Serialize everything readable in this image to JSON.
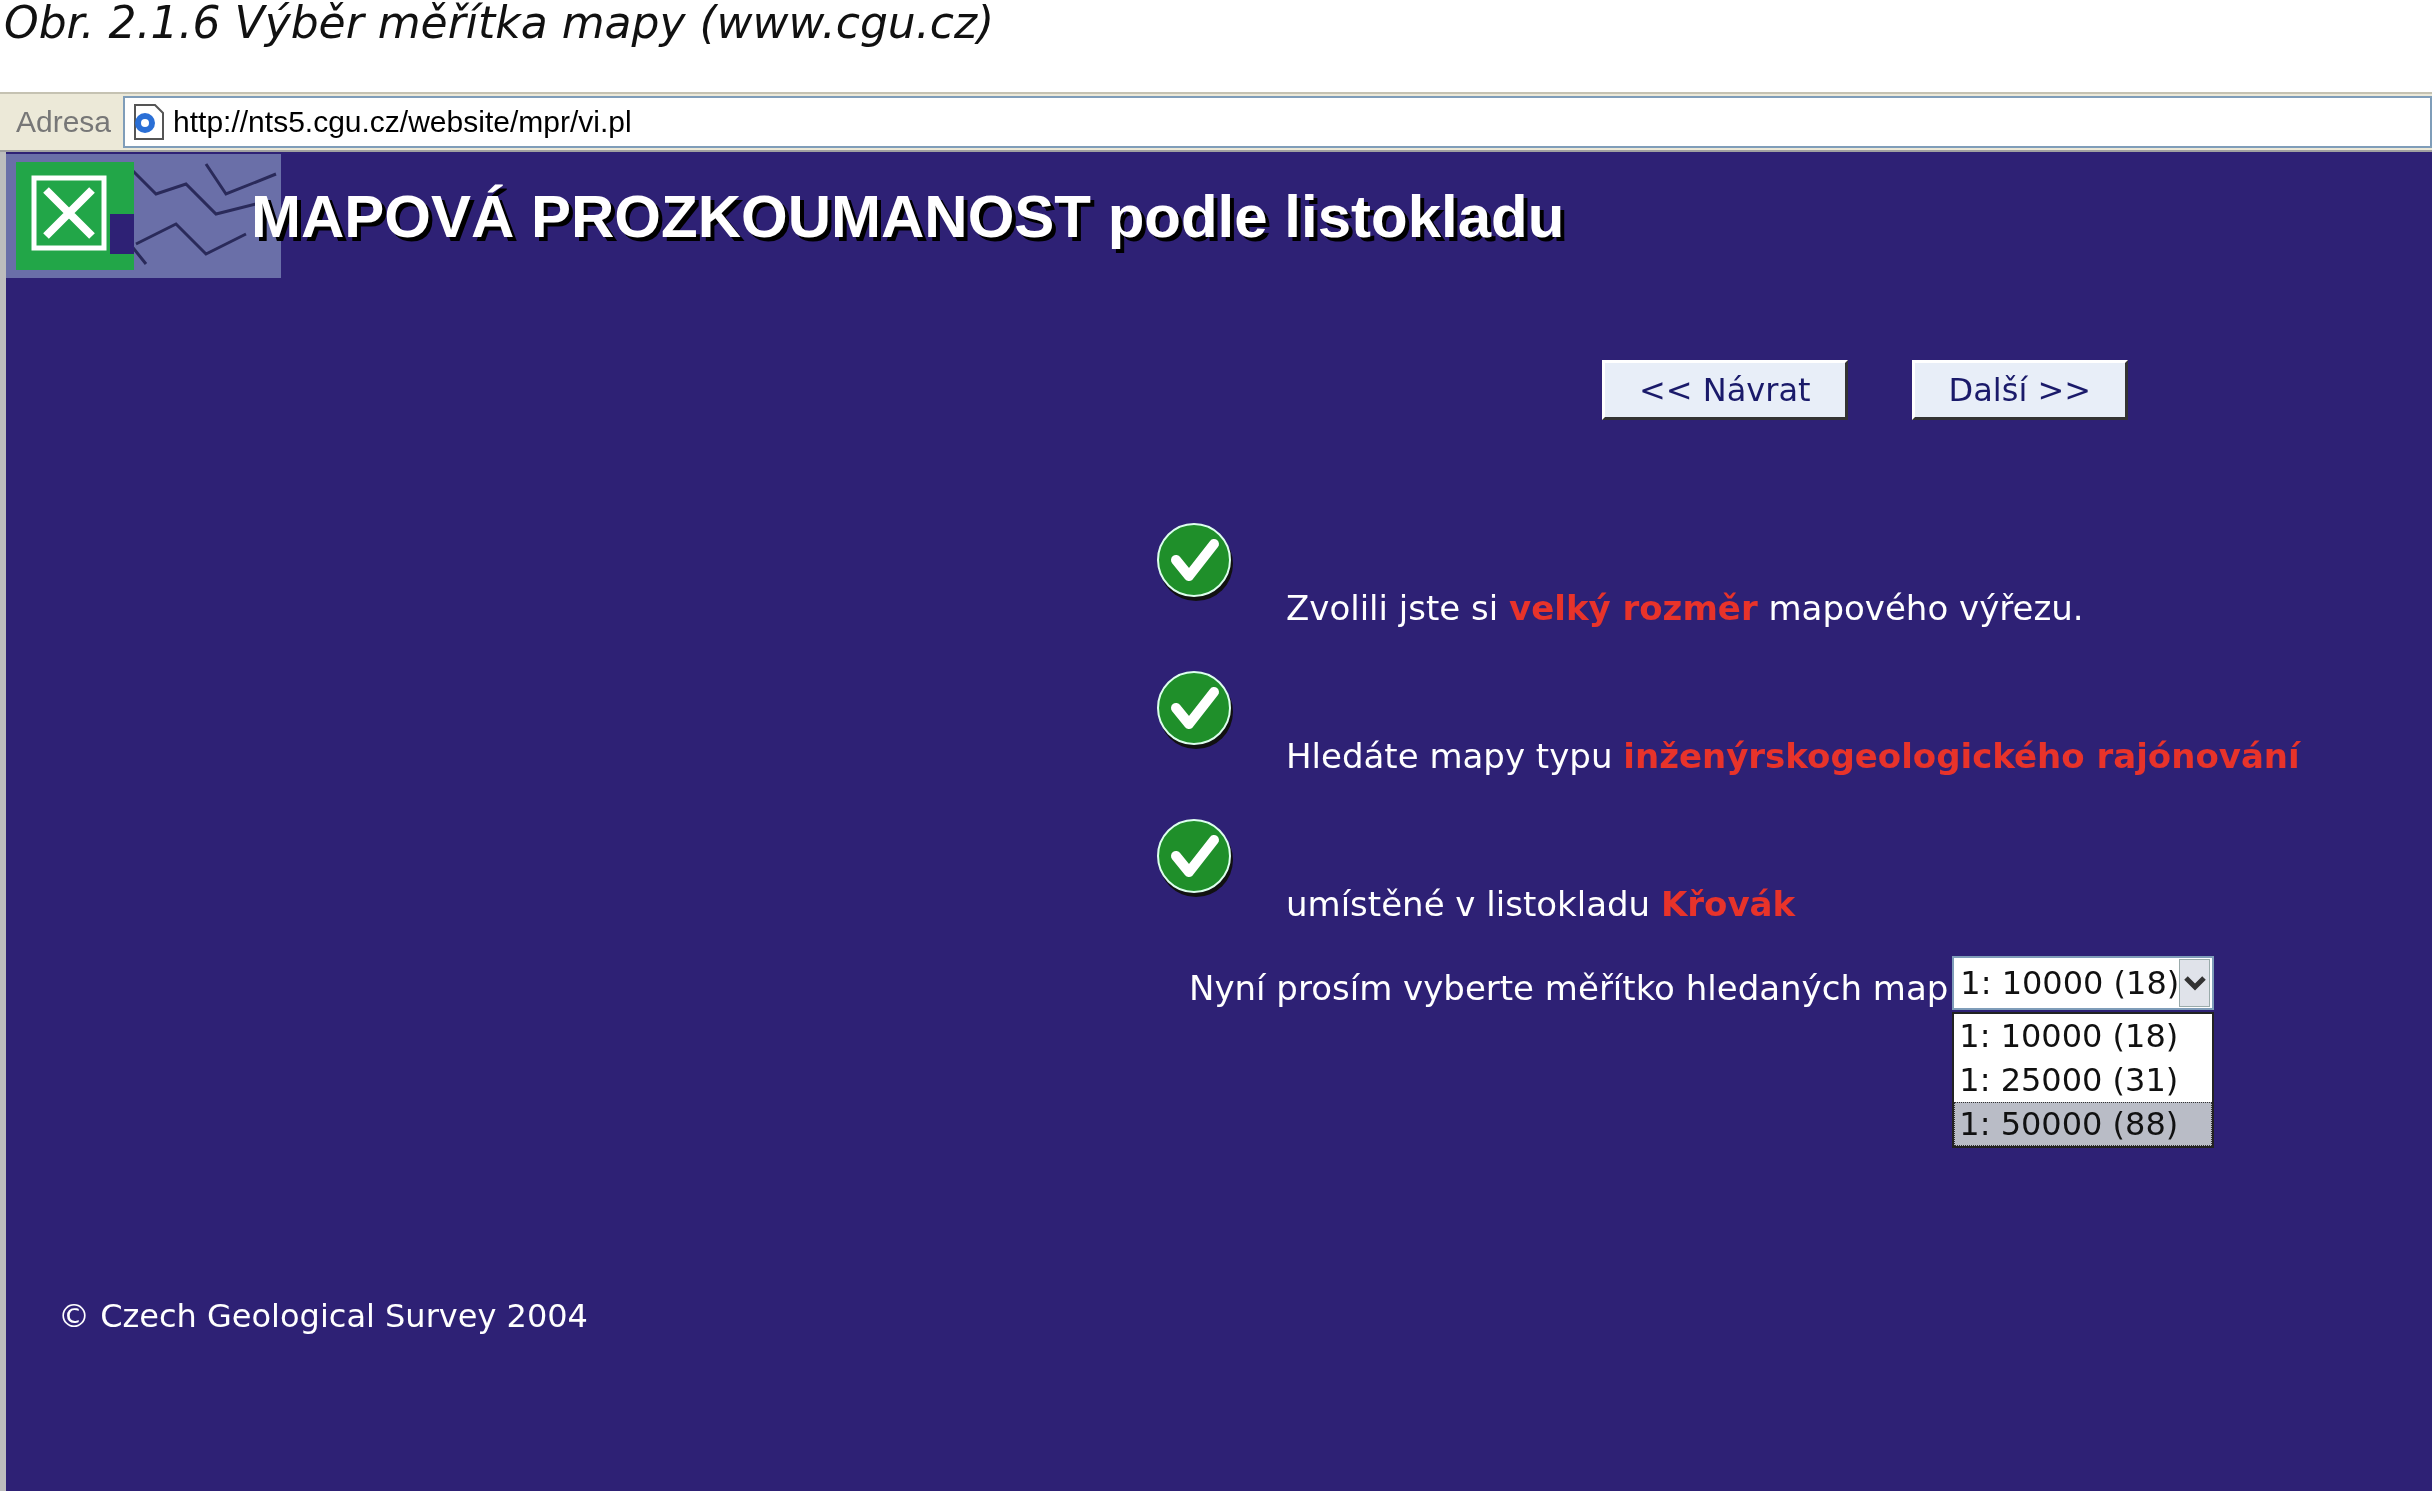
{
  "caption": "Obr. 2.1.6 Výběr měřítka mapy (www.cgu.cz)",
  "address_bar": {
    "label": "Adresa",
    "url": "http://nts5.cgu.cz/website/mpr/vi.pl"
  },
  "header": {
    "title": "MAPOVÁ PROZKOUMANOST podle listokladu"
  },
  "buttons": [
    "<< Návrat",
    "Další >>"
  ],
  "steps": [
    {
      "text": "Zvolili jste si **velký rozměr** mapového výřezu.",
      "checked": true
    },
    {
      "text": "Hledáte mapy typu **inženýrskogeologického rajónování**",
      "checked": true
    },
    {
      "text": "umístěné v listokladu **Křovák**",
      "checked": true
    }
  ],
  "scale_select": {
    "label": "Nyní prosím vyberte měřítko hledaných map",
    "value": "1: 10000 (18)",
    "expanded": true,
    "options": [
      {
        "label": "1: 10000 (18)",
        "highlighted": false
      },
      {
        "label": "1: 25000 (31)",
        "highlighted": false
      },
      {
        "label": "1: 50000 (88)",
        "highlighted": true
      }
    ]
  },
  "footer": "© Czech Geological Survey 2004"
}
